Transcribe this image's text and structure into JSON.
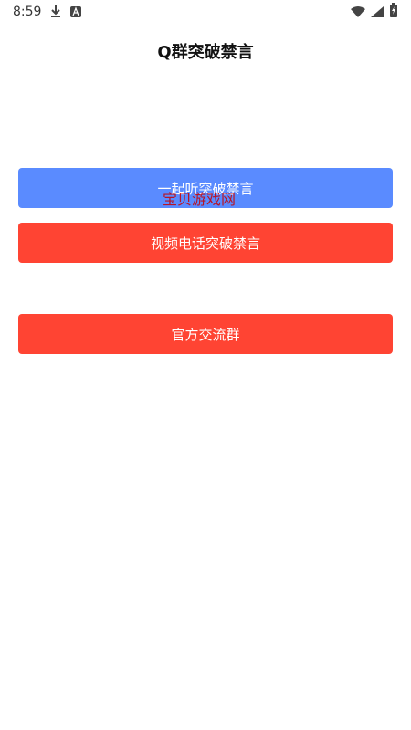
{
  "status_bar": {
    "time": "8:59",
    "icons": [
      "download-icon",
      "a-icon",
      "wifi-icon",
      "signal-icon",
      "battery-icon"
    ]
  },
  "header": {
    "title": "Q群突破禁言"
  },
  "buttons": {
    "listen_together": "一起听突破禁言",
    "video_call": "视频电话突破禁言",
    "official_group": "官方交流群"
  },
  "watermark": {
    "text": "宝贝游戏网"
  },
  "colors": {
    "blue_button": "#5a8bff",
    "red_button": "#ff4433",
    "watermark": "#c80000"
  }
}
